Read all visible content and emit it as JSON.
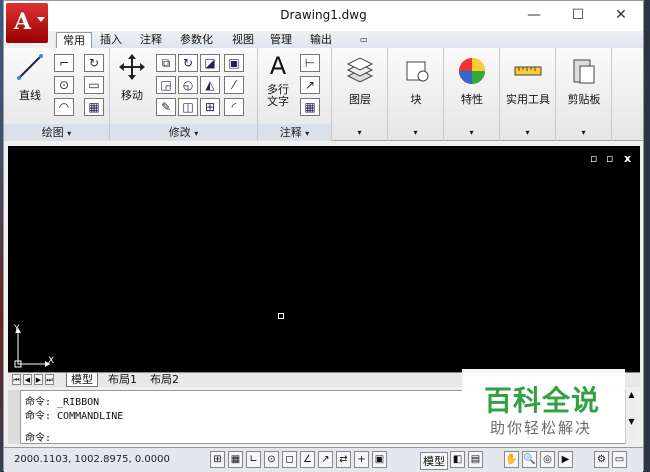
{
  "window": {
    "title": "Drawing1.dwg",
    "min": "—",
    "max": "☐",
    "close": "✕"
  },
  "app_button": {
    "glyph": "A"
  },
  "tabs": [
    {
      "label": "常用"
    },
    {
      "label": "插入"
    },
    {
      "label": "注释"
    },
    {
      "label": "参数化"
    },
    {
      "label": "视图"
    },
    {
      "label": "管理"
    },
    {
      "label": "输出"
    }
  ],
  "panels": {
    "draw": {
      "label": "绘图",
      "line_label": "直线"
    },
    "modify": {
      "label": "修改",
      "move_label": "移动"
    },
    "annotation": {
      "label": "注释",
      "mtext_label": "多行\n文字",
      "mtext_glyph": "A"
    },
    "layers": {
      "label": "图层"
    },
    "block": {
      "label": "块"
    },
    "properties": {
      "label": "特性"
    },
    "utilities": {
      "label": "实用工具"
    },
    "clipboard": {
      "label": "剪贴板"
    }
  },
  "canvas": {
    "restore": "▫",
    "max": "▫",
    "close": "x",
    "ucs_y": "Y",
    "ucs_x": "X"
  },
  "layout_tabs": [
    {
      "label": "模型"
    },
    {
      "label": "布局1"
    },
    {
      "label": "布局2"
    }
  ],
  "command": {
    "history": [
      "命令: _RIBBON",
      "命令: COMMANDLINE"
    ],
    "prompt": "命令:"
  },
  "status": {
    "coords": "2000.1103, 1002.8975, 0.0000",
    "model": "模型"
  },
  "watermark": {
    "title": "百科全说",
    "subtitle": "助你轻松解决"
  },
  "colors": {
    "accent": "#cc2222",
    "canvas": "#000000",
    "watermark_green": "#2a9d3c"
  }
}
